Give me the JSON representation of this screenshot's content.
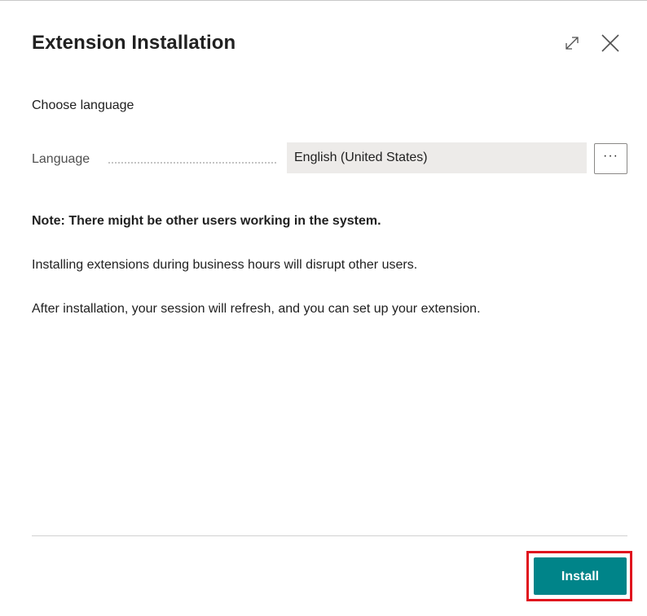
{
  "dialog": {
    "title": "Extension Installation",
    "expand_icon": "expand-diagonal-icon",
    "close_icon": "close-icon"
  },
  "form": {
    "subtitle": "Choose language",
    "language_label": "Language",
    "language_value": "English (United States)",
    "lookup_label": "···"
  },
  "content": {
    "note": "Note: There might be other users working in the system.",
    "paragraph1": "Installing extensions during business hours will disrupt other users.",
    "paragraph2": "After installation, your session will refresh, and you can set up your extension."
  },
  "footer": {
    "install_label": "Install"
  },
  "colors": {
    "primary": "#008489",
    "highlight": "#e0141e",
    "field_background": "#edebe9"
  }
}
